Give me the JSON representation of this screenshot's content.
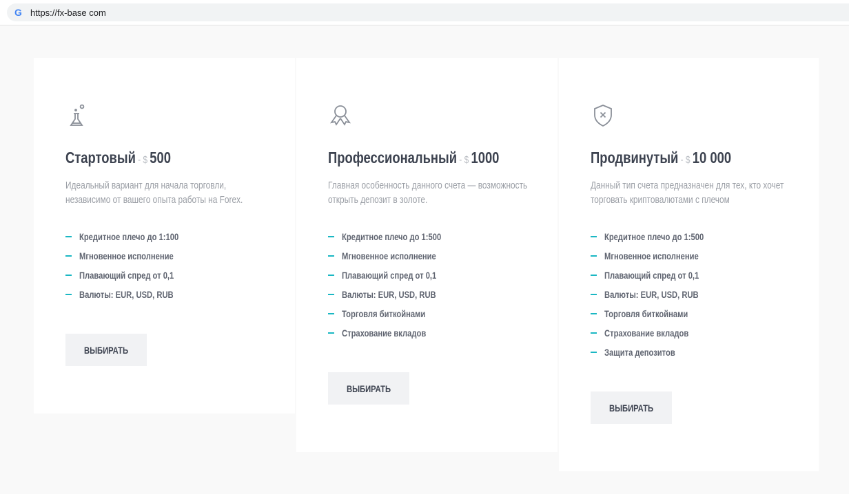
{
  "browser": {
    "url": "https://fx-base com"
  },
  "colors": {
    "accent": "#1ab7c3",
    "title": "#3d4350",
    "button_bg": "#f1f2f4"
  },
  "plans": [
    {
      "icon": "flask-icon",
      "name": "Стартовый",
      "sep": "- $",
      "price": "500",
      "description": [
        "Идеальный вариант для начала торговли,",
        "независимо от вашего опыта работы на Forex."
      ],
      "features": [
        "Кредитное плечо до 1:100",
        "Мгновенное исполнение",
        "Плавающий спред от 0,1",
        "Валюты: EUR, USD, RUB"
      ],
      "button": "ВЫБИРАТЬ"
    },
    {
      "icon": "award-ribbon-icon",
      "name": "Профессиональный",
      "sep": "- $",
      "price": "1000",
      "description": [
        "Главная особенность данного счета — возможность",
        "открыть депозит в золоте."
      ],
      "features": [
        "Кредитное плечо до 1:500",
        "Мгновенное исполнение",
        "Плавающий спред от 0,1",
        "Валюты: EUR, USD, RUB",
        "Торговля биткойнами",
        "Страхование вкладов"
      ],
      "button": "ВЫБИРАТЬ"
    },
    {
      "icon": "shield-x-icon",
      "name": "Продвинутый",
      "sep": "- $",
      "price": "10 000",
      "description": [
        "Данный тип счета предназначен для тех, кто хочет",
        "торговать криптовалютами с плечом"
      ],
      "features": [
        "Кредитное плечо до 1:500",
        "Мгновенное исполнение",
        "Плавающий спред от 0,1",
        "Валюты: EUR, USD, RUB",
        "Торговля биткойнами",
        "Страхование вкладов",
        "Защита депозитов"
      ],
      "button": "ВЫБИРАТЬ"
    }
  ]
}
